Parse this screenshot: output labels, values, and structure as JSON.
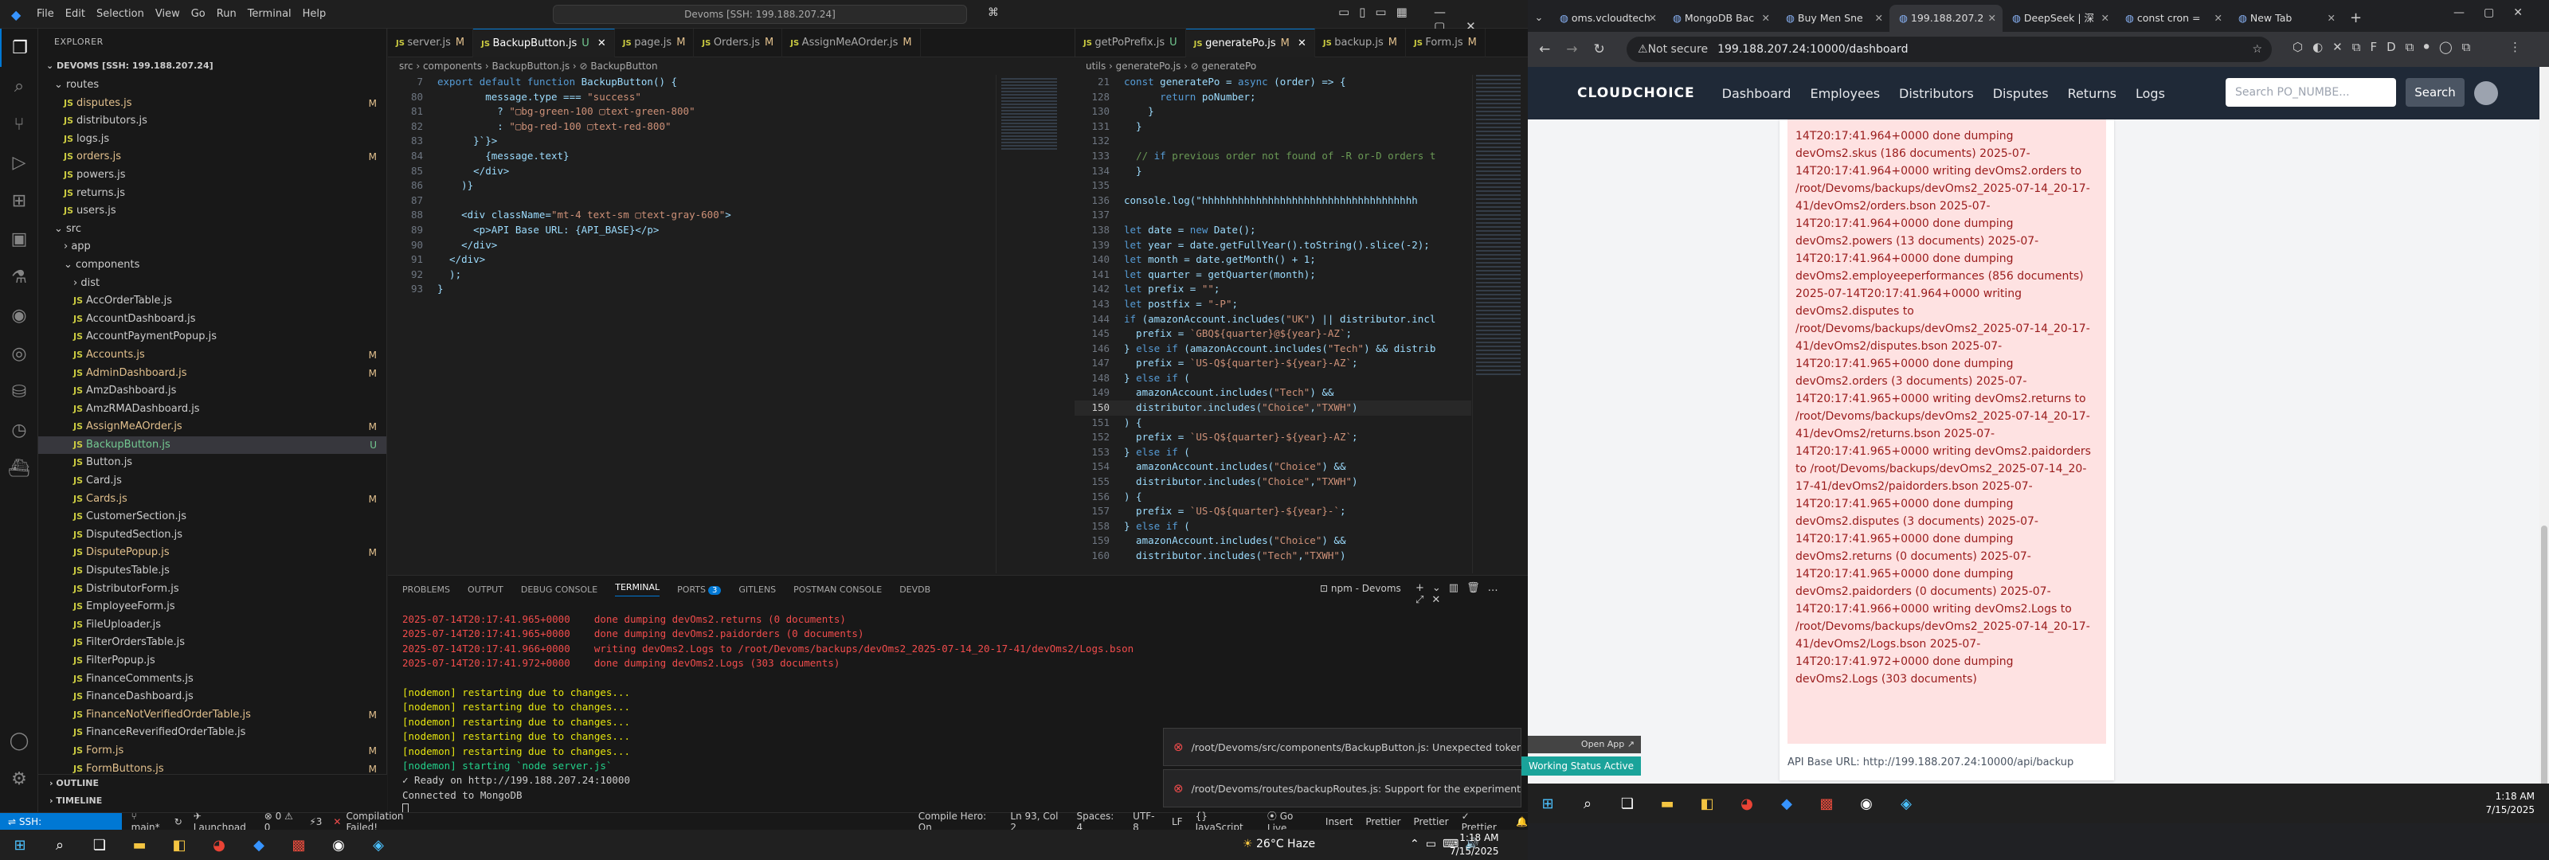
{
  "vscode": {
    "menu": [
      "File",
      "Edit",
      "Selection",
      "View",
      "Go",
      "Run",
      "Terminal",
      "Help"
    ],
    "command_center": "Devoms [SSH: 199.188.207.24]",
    "explorer_title": "EXPLORER",
    "workspace": "DEVOMS [SSH: 199.188.207.24]",
    "tree": [
      {
        "label": "routes",
        "type": "folder",
        "indent": 1,
        "status": ""
      },
      {
        "label": "disputes.js",
        "type": "js",
        "indent": 2,
        "status": "M"
      },
      {
        "label": "distributors.js",
        "type": "js",
        "indent": 2,
        "status": ""
      },
      {
        "label": "logs.js",
        "type": "js",
        "indent": 2,
        "status": ""
      },
      {
        "label": "orders.js",
        "type": "js",
        "indent": 2,
        "status": "M"
      },
      {
        "label": "powers.js",
        "type": "js",
        "indent": 2,
        "status": ""
      },
      {
        "label": "returns.js",
        "type": "js",
        "indent": 2,
        "status": ""
      },
      {
        "label": "users.js",
        "type": "js",
        "indent": 2,
        "status": ""
      },
      {
        "label": "src",
        "type": "folder",
        "indent": 1,
        "status": ""
      },
      {
        "label": "app",
        "type": "folder-closed",
        "indent": 2,
        "status": ""
      },
      {
        "label": "components",
        "type": "folder",
        "indent": 2,
        "status": ""
      },
      {
        "label": "dist",
        "type": "folder-closed",
        "indent": 3,
        "status": ""
      },
      {
        "label": "AccOrderTable.js",
        "type": "js",
        "indent": 3,
        "status": ""
      },
      {
        "label": "AccountDashboard.js",
        "type": "js",
        "indent": 3,
        "status": ""
      },
      {
        "label": "AccountPaymentPopup.js",
        "type": "js",
        "indent": 3,
        "status": ""
      },
      {
        "label": "Accounts.js",
        "type": "js",
        "indent": 3,
        "status": "M"
      },
      {
        "label": "AdminDashboard.js",
        "type": "js",
        "indent": 3,
        "status": "M"
      },
      {
        "label": "AmzDashboard.js",
        "type": "js",
        "indent": 3,
        "status": ""
      },
      {
        "label": "AmzRMADashboard.js",
        "type": "js",
        "indent": 3,
        "status": ""
      },
      {
        "label": "AssignMeAOrder.js",
        "type": "js",
        "indent": 3,
        "status": "M"
      },
      {
        "label": "BackupButton.js",
        "type": "js",
        "indent": 3,
        "status": "U",
        "selected": true
      },
      {
        "label": "Button.js",
        "type": "js",
        "indent": 3,
        "status": ""
      },
      {
        "label": "Card.js",
        "type": "js",
        "indent": 3,
        "status": ""
      },
      {
        "label": "Cards.js",
        "type": "js",
        "indent": 3,
        "status": "M"
      },
      {
        "label": "CustomerSection.js",
        "type": "js",
        "indent": 3,
        "status": ""
      },
      {
        "label": "DisputedSection.js",
        "type": "js",
        "indent": 3,
        "status": ""
      },
      {
        "label": "DisputePopup.js",
        "type": "js",
        "indent": 3,
        "status": "M"
      },
      {
        "label": "DisputesTable.js",
        "type": "js",
        "indent": 3,
        "status": ""
      },
      {
        "label": "DistributorForm.js",
        "type": "js",
        "indent": 3,
        "status": ""
      },
      {
        "label": "EmployeeForm.js",
        "type": "js",
        "indent": 3,
        "status": ""
      },
      {
        "label": "FileUploader.js",
        "type": "js",
        "indent": 3,
        "status": ""
      },
      {
        "label": "FilterOrdersTable.js",
        "type": "js",
        "indent": 3,
        "status": ""
      },
      {
        "label": "FilterPopup.js",
        "type": "js",
        "indent": 3,
        "status": ""
      },
      {
        "label": "FinanceComments.js",
        "type": "js",
        "indent": 3,
        "status": ""
      },
      {
        "label": "FinanceDashboard.js",
        "type": "js",
        "indent": 3,
        "status": ""
      },
      {
        "label": "FinanceNotVerifiedOrderTable.js",
        "type": "js",
        "indent": 3,
        "status": "M"
      },
      {
        "label": "FinanceReverifiedOrderTable.js",
        "type": "js",
        "indent": 3,
        "status": ""
      },
      {
        "label": "Form.js",
        "type": "js",
        "indent": 3,
        "status": "M"
      },
      {
        "label": "FormButtons.js",
        "type": "js",
        "indent": 3,
        "status": "M"
      }
    ],
    "outline": [
      "OUTLINE",
      "TIMELINE"
    ],
    "tabs_left": [
      {
        "label": "server.js",
        "st": "M"
      },
      {
        "label": "BackupButton.js",
        "st": "U",
        "active": true
      },
      {
        "label": "page.js",
        "st": "M"
      },
      {
        "label": "Orders.js",
        "st": "M"
      },
      {
        "label": "AssignMeAOrder.js",
        "st": "M"
      }
    ],
    "tabs_right": [
      {
        "label": "getPoPrefix.js",
        "st": "U"
      },
      {
        "label": "generatePo.js",
        "st": "M",
        "active": true
      },
      {
        "label": "backup.js",
        "st": "M"
      },
      {
        "label": "Form.js",
        "st": "M"
      }
    ],
    "crumb_left": "src › components › BackupButton.js › ⊘ BackupButton",
    "crumb_right": "utils › generatePo.js › ⊘ generatePo",
    "editor_left_lines": [
      {
        "n": "7",
        "t": "export default function BackupButton() {"
      },
      {
        "n": "80",
        "t": "        message.type === \"success\""
      },
      {
        "n": "81",
        "t": "          ? \"▢bg-green-100 ▢text-green-800\""
      },
      {
        "n": "82",
        "t": "          : \"▢bg-red-100 ▢text-red-800\""
      },
      {
        "n": "83",
        "t": "      }`}>"
      },
      {
        "n": "84",
        "t": "        {message.text}"
      },
      {
        "n": "85",
        "t": "      </div>"
      },
      {
        "n": "86",
        "t": "    )}"
      },
      {
        "n": "87",
        "t": ""
      },
      {
        "n": "88",
        "t": "    <div className=\"mt-4 text-sm ▢text-gray-600\">"
      },
      {
        "n": "89",
        "t": "      <p>API Base URL: {API_BASE}</p>"
      },
      {
        "n": "90",
        "t": "    </div>"
      },
      {
        "n": "91",
        "t": "  </div>"
      },
      {
        "n": "92",
        "t": "  );"
      },
      {
        "n": "93",
        "t": "}"
      }
    ],
    "editor_right_lines": [
      {
        "n": "21",
        "t": "const generatePo = async (order) => {"
      },
      {
        "n": "128",
        "t": "      return poNumber;"
      },
      {
        "n": "130",
        "t": "    }"
      },
      {
        "n": "131",
        "t": "  }"
      },
      {
        "n": "132",
        "t": ""
      },
      {
        "n": "133",
        "t": "  // if previous order not found of -R or-D orders t"
      },
      {
        "n": "134",
        "t": "  }"
      },
      {
        "n": "135",
        "t": ""
      },
      {
        "n": "136",
        "t": "console.log(\"hhhhhhhhhhhhhhhhhhhhhhhhhhhhhhhhhhhh"
      },
      {
        "n": "137",
        "t": ""
      },
      {
        "n": "138",
        "t": "let date = new Date();"
      },
      {
        "n": "139",
        "t": "let year = date.getFullYear().toString().slice(-2);"
      },
      {
        "n": "140",
        "t": "let month = date.getMonth() + 1;"
      },
      {
        "n": "141",
        "t": "let quarter = getQuarter(month);"
      },
      {
        "n": "142",
        "t": "let prefix = \"\";"
      },
      {
        "n": "143",
        "t": "let postfix = \"-P\";"
      },
      {
        "n": "144",
        "t": "if (amazonAccount.includes(\"UK\") || distributor.incl"
      },
      {
        "n": "145",
        "t": "  prefix = `GBQ${quarter}@${year}-AZ`;"
      },
      {
        "n": "146",
        "t": "} else if (amazonAccount.includes(\"Tech\") && distrib"
      },
      {
        "n": "147",
        "t": "  prefix = `US-Q${quarter}-${year}-AZ`;"
      },
      {
        "n": "148",
        "t": "} else if ("
      },
      {
        "n": "149",
        "t": "  amazonAccount.includes(\"Tech\") &&"
      },
      {
        "n": "150",
        "t": "  distributor.includes(\"Choice\",\"TXWH\")",
        "cur": true
      },
      {
        "n": "151",
        "t": ") {"
      },
      {
        "n": "152",
        "t": "  prefix = `US-Q${quarter}-${year}-AZ`;"
      },
      {
        "n": "153",
        "t": "} else if ("
      },
      {
        "n": "154",
        "t": "  amazonAccount.includes(\"Choice\") &&"
      },
      {
        "n": "155",
        "t": "  distributor.includes(\"Choice\",\"TXWH\")"
      },
      {
        "n": "156",
        "t": ") {"
      },
      {
        "n": "157",
        "t": "  prefix = `US-Q${quarter}-${year}-`;"
      },
      {
        "n": "158",
        "t": "} else if ("
      },
      {
        "n": "159",
        "t": "  amazonAccount.includes(\"Choice\") &&"
      },
      {
        "n": "160",
        "t": "  distributor.includes(\"Tech\",\"TXWH\")"
      }
    ],
    "panel_tabs": [
      "PROBLEMS",
      "OUTPUT",
      "DEBUG CONSOLE",
      "TERMINAL",
      "PORTS",
      "GITLENS",
      "POSTMAN CONSOLE",
      "DEVDB"
    ],
    "ports_badge": "3",
    "terminal_name": "npm - Devoms",
    "terminal_lines": [
      {
        "t": "2025-07-14T20:17:41.965+0000    done dumping devOms2.returns (0 documents)",
        "c": "#f14c4c"
      },
      {
        "t": "2025-07-14T20:17:41.965+0000    done dumping devOms2.paidorders (0 documents)",
        "c": "#f14c4c"
      },
      {
        "t": "2025-07-14T20:17:41.966+0000    writing devOms2.Logs to /root/Devoms/backups/devOms2_2025-07-14_20-17-41/devOms2/Logs.bson",
        "c": "#f14c4c"
      },
      {
        "t": "2025-07-14T20:17:41.972+0000    done dumping devOms2.Logs (303 documents)",
        "c": "#f14c4c"
      },
      {
        "t": "",
        "c": "#ccc"
      },
      {
        "t": "[nodemon] restarting due to changes...",
        "c": "#e5e510"
      },
      {
        "t": "[nodemon] restarting due to changes...",
        "c": "#e5e510"
      },
      {
        "t": "[nodemon] restarting due to changes...",
        "c": "#e5e510"
      },
      {
        "t": "[nodemon] restarting due to changes...",
        "c": "#e5e510"
      },
      {
        "t": "[nodemon] restarting due to changes...",
        "c": "#e5e510"
      },
      {
        "t": "[nodemon] starting `node server.js`",
        "c": "#23d18b"
      },
      {
        "t": "✓ Ready on http://199.188.207.24:10000",
        "c": "#ccc"
      },
      {
        "t": "Connected to MongoDB",
        "c": "#ccc"
      }
    ],
    "notifications": [
      "/root/Devoms/src/components/BackupButton.js: Unexpected token (5...",
      "/root/Devoms/routes/backupRoutes.js: Support for the experimental s..."
    ],
    "status": {
      "remote": "SSH: 199.188.207.24",
      "branch": "main*",
      "sync": "↻",
      "launch": "Launchpad",
      "errors": "⊗ 0 ⚠ 0",
      "ports": "⚡3",
      "compile_msg": "Compilation Failed!",
      "compile_hero": "Compile Hero: On",
      "position": "Ln 93, Col 2",
      "spaces": "Spaces: 4",
      "encoding": "UTF-8",
      "eol": "LF",
      "lang": "{} JavaScript",
      "golive": "⦿ Go Live",
      "insert": "Insert",
      "prettier1": "Prettier",
      "prettier2": "Prettier",
      "prettier3": "✓ Prettier"
    },
    "weather": "26°C  Haze",
    "clock_time": "1:18 AM",
    "clock_date": "7/15/2025"
  },
  "browser": {
    "tabs": [
      {
        "label": "oms.vcloudtech"
      },
      {
        "label": "MongoDB Bac"
      },
      {
        "label": "Buy Men Sne"
      },
      {
        "label": "199.188.207.2",
        "active": true
      },
      {
        "label": "DeepSeek | 深"
      },
      {
        "label": "const cron ="
      },
      {
        "label": "New Tab"
      }
    ],
    "not_secure": "Not secure",
    "url": "199.188.207.24:10000/dashboard",
    "logo": "CLOUDCHOICE",
    "nav": [
      "Dashboard",
      "Employees",
      "Distributors",
      "Disputes",
      "Returns",
      "Logs"
    ],
    "search_placeholder": "Search PO_NUMBE...",
    "search_button": "Search",
    "message": "14T20:17:41.964+0000 done dumping devOms2.skus (186 documents) 2025-07-14T20:17:41.964+0000 writing devOms2.orders to /root/Devoms/backups/devOms2_2025-07-14_20-17-41/devOms2/orders.bson 2025-07-14T20:17:41.964+0000 done dumping devOms2.powers (13 documents) 2025-07-14T20:17:41.964+0000 done dumping devOms2.employeeperformances (856 documents) 2025-07-14T20:17:41.964+0000 writing devOms2.disputes to /root/Devoms/backups/devOms2_2025-07-14_20-17-41/devOms2/disputes.bson 2025-07-14T20:17:41.965+0000 done dumping devOms2.orders (3 documents) 2025-07-14T20:17:41.965+0000 writing devOms2.returns to /root/Devoms/backups/devOms2_2025-07-14_20-17-41/devOms2/returns.bson 2025-07-14T20:17:41.965+0000 writing devOms2.paidorders to /root/Devoms/backups/devOms2_2025-07-14_20-17-41/devOms2/paidorders.bson 2025-07-14T20:17:41.965+0000 done dumping devOms2.disputes (3 documents) 2025-07-14T20:17:41.965+0000 done dumping devOms2.returns (0 documents) 2025-07-14T20:17:41.965+0000 done dumping devOms2.paidorders (0 documents) 2025-07-14T20:17:41.966+0000 writing devOms2.Logs to /root/Devoms/backups/devOms2_2025-07-14_20-17-41/devOms2/Logs.bson 2025-07-14T20:17:41.972+0000 done dumping devOms2.Logs (303 documents)",
    "api_base": "API Base URL: http://199.188.207.24:10000/api/backup",
    "open_app": "Open App ↗",
    "working_status": "Working Status Active",
    "clock_time": "1:18 AM",
    "clock_date": "7/15/2025"
  }
}
